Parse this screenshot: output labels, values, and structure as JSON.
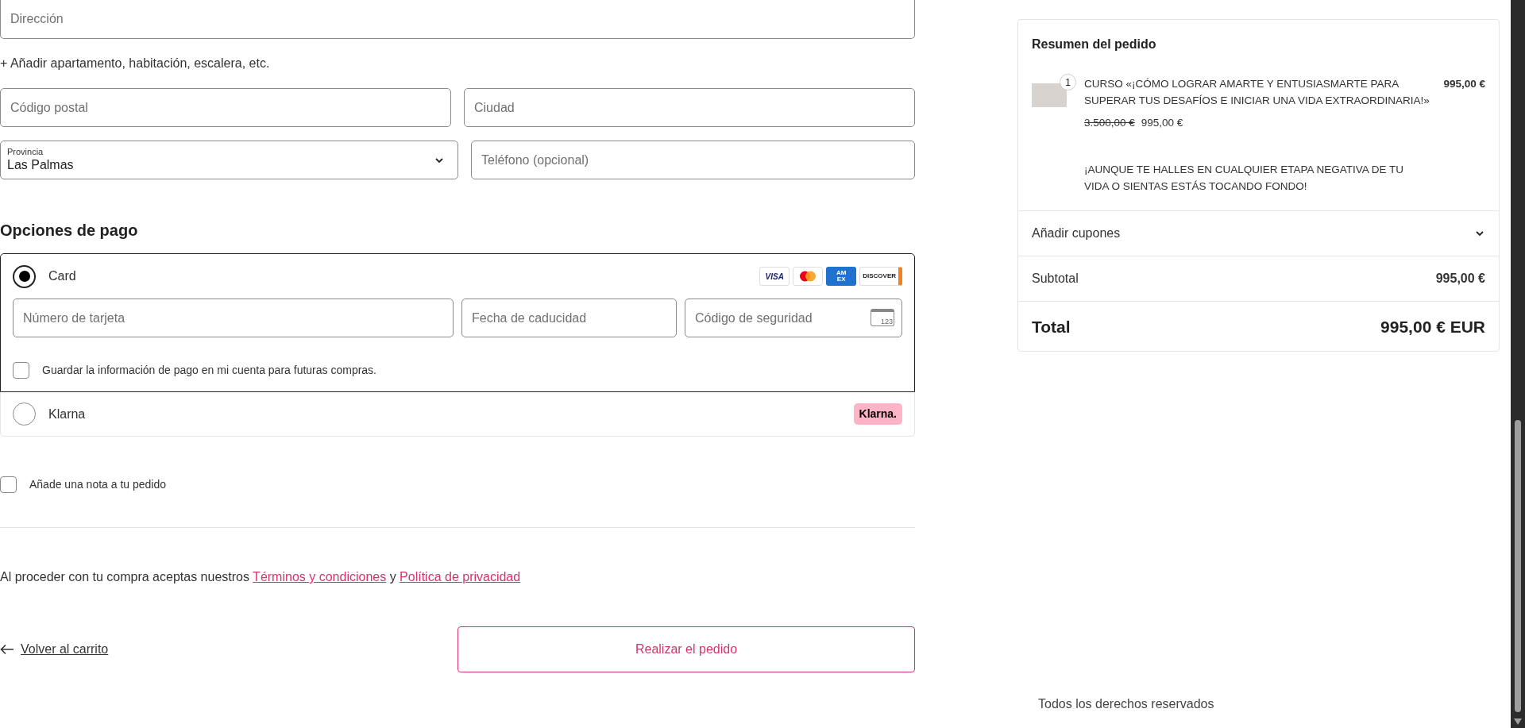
{
  "address": {
    "street": {
      "placeholder": "Dirección"
    },
    "add_line_link": "+ Añadir apartamento, habitación, escalera, etc.",
    "postal_code": {
      "placeholder": "Código postal"
    },
    "city": {
      "placeholder": "Ciudad"
    },
    "province": {
      "label": "Provincia",
      "value": "Las Palmas"
    },
    "phone": {
      "placeholder": "Teléfono (opcional)"
    }
  },
  "payment": {
    "title": "Opciones de pago",
    "methods": [
      {
        "kind": "card",
        "label": "Card",
        "selected": true,
        "brands": [
          {
            "kind": "visa",
            "text": "VISA"
          },
          {
            "kind": "mastercard"
          },
          {
            "kind": "amex",
            "text": "AM EX"
          },
          {
            "kind": "discover",
            "text": "DISCOVER"
          }
        ],
        "card_number": {
          "placeholder": "Número de tarjeta"
        },
        "expiry": {
          "placeholder": "Fecha de caducidad"
        },
        "security_code": {
          "placeholder": "Código de seguridad",
          "icon_text": "123"
        },
        "save_info": {
          "label": "Guardar la información de pago en mi cuenta para futuras compras.",
          "checked": false
        }
      },
      {
        "kind": "klarna",
        "label": "Klarna",
        "selected": false,
        "badge": "Klarna."
      }
    ]
  },
  "order_note": {
    "label": "Añade una nota a tu pedido",
    "checked": false
  },
  "terms": {
    "text": "Al proceder con tu compra aceptas nuestros",
    "links": [
      "Términos y condiciones",
      "Política de privacidad"
    ],
    "joiner": "y"
  },
  "back_link": "Volver al carrito",
  "submit_button": "Realizar el pedido",
  "summary": {
    "title": "Resumen del pedido",
    "items": [
      {
        "quantity": "1",
        "name": "CURSO «¡CÓMO LOGRAR AMARTE Y ENTUSIASMARTE PARA SUPERAR TUS DESAFÍOS E INICIAR UNA VIDA EXTRAORDINARIA!»",
        "price": "995,00 €",
        "compare_at_price": "3.500,00 €",
        "sale_price": "995,00 €",
        "description": "¡AUNQUE TE HALLES EN CUALQUIER ETAPA NEGATIVA DE TU VIDA O SIENTAS ESTÁS TOCANDO FONDO!"
      }
    ],
    "coupons": {
      "label": "Añadir cupones",
      "expanded": false
    },
    "subtotal": {
      "label": "Subtotal",
      "value": "995,00 €"
    },
    "total": {
      "label": "Total",
      "value": "995,00 € EUR"
    }
  },
  "footer": "Todos los derechos reservados"
}
